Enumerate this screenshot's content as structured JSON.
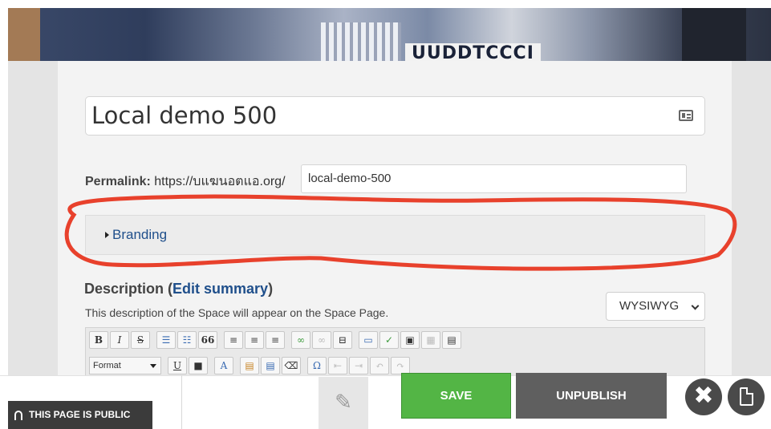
{
  "banner": {
    "text": "UUDDTCCCI"
  },
  "page": {
    "title_value": "Local demo 500",
    "permalink": {
      "label": "Permalink:",
      "base_url": "https://บแฆนอตแอ.org/",
      "slug": "local-demo-500"
    },
    "branding": {
      "label": "Branding"
    },
    "description": {
      "heading": "Description (",
      "edit_link": "Edit summary",
      "heading_end": ")",
      "subtext": "This description of the Space will appear on the Space Page."
    },
    "editor_mode": {
      "selected": "WYSIWYG"
    },
    "toolbar": {
      "bold": "B",
      "italic": "I",
      "strike": "S",
      "format_select": "Format",
      "underline": "U",
      "quote": "66",
      "omega": "Ω"
    }
  },
  "footer": {
    "public_badge": "THIS PAGE IS PUBLIC",
    "save_label": "SAVE",
    "unpublish_label": "UNPUBLISH",
    "close_symbol": "✖"
  },
  "colors": {
    "save_green": "#53b545",
    "unpublish_gray": "#5f5f5f",
    "link_blue": "#1f4f8b",
    "annotation_red": "#e8412c"
  }
}
